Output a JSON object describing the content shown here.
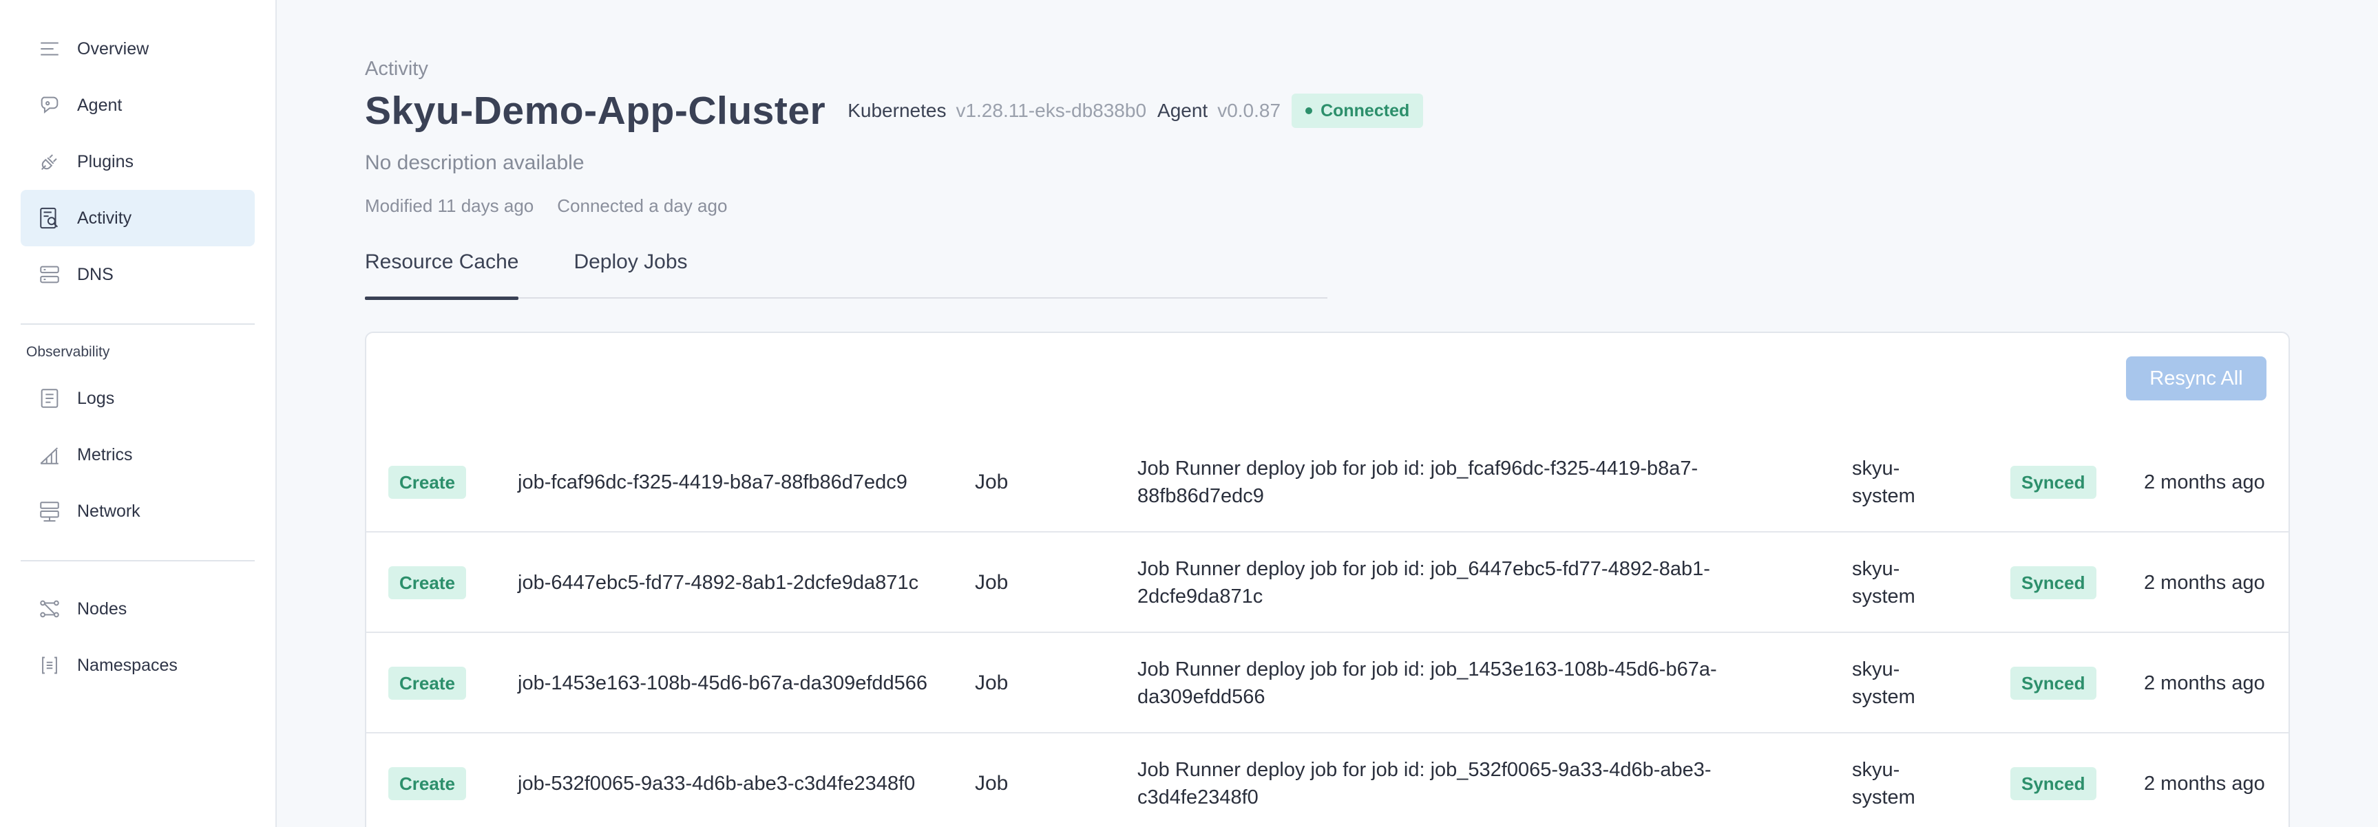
{
  "sidebar": {
    "main_items": [
      {
        "label": "Overview",
        "icon": "overview-lines-icon"
      },
      {
        "label": "Agent",
        "icon": "agent-icon"
      },
      {
        "label": "Plugins",
        "icon": "plug-icon"
      },
      {
        "label": "Activity",
        "icon": "activity-icon",
        "active": true
      },
      {
        "label": "DNS",
        "icon": "dns-icon"
      }
    ],
    "observability_label": "Observability",
    "observability_items": [
      {
        "label": "Logs",
        "icon": "logs-icon"
      },
      {
        "label": "Metrics",
        "icon": "metrics-icon"
      },
      {
        "label": "Network",
        "icon": "network-icon"
      }
    ],
    "cluster_items": [
      {
        "label": "Nodes",
        "icon": "nodes-icon"
      },
      {
        "label": "Namespaces",
        "icon": "namespaces-icon"
      }
    ]
  },
  "header": {
    "breadcrumb": "Activity",
    "title": "Skyu-Demo-App-Cluster",
    "kubernetes_label": "Kubernetes",
    "kubernetes_version": "v1.28.11-eks-db838b0",
    "agent_label": "Agent",
    "agent_version": "v0.0.87",
    "status": "Connected",
    "description": "No description available",
    "modified": "Modified 11 days ago",
    "connected": "Connected a day ago"
  },
  "tabs": [
    {
      "label": "Resource Cache",
      "active": true
    },
    {
      "label": "Deploy Jobs",
      "active": false
    }
  ],
  "table": {
    "resync_label": "Resync All",
    "rows": [
      {
        "action": "Create",
        "name": "job-fcaf96dc-f325-4419-b8a7-88fb86d7edc9",
        "kind": "Job",
        "description": "Job Runner deploy job for job id: job_fcaf96dc-f325-4419-b8a7-88fb86d7edc9",
        "namespace": "skyu-system",
        "status": "Synced",
        "time": "2 months ago"
      },
      {
        "action": "Create",
        "name": "job-6447ebc5-fd77-4892-8ab1-2dcfe9da871c",
        "kind": "Job",
        "description": "Job Runner deploy job for job id: job_6447ebc5-fd77-4892-8ab1-2dcfe9da871c",
        "namespace": "skyu-system",
        "status": "Synced",
        "time": "2 months ago"
      },
      {
        "action": "Create",
        "name": "job-1453e163-108b-45d6-b67a-da309efdd566",
        "kind": "Job",
        "description": "Job Runner deploy job for job id: job_1453e163-108b-45d6-b67a-da309efdd566",
        "namespace": "skyu-system",
        "status": "Synced",
        "time": "2 months ago"
      },
      {
        "action": "Create",
        "name": "job-532f0065-9a33-4d6b-abe3-c3d4fe2348f0",
        "kind": "Job",
        "description": "Job Runner deploy job for job id: job_532f0065-9a33-4d6b-abe3-c3d4fe2348f0",
        "namespace": "skyu-system",
        "status": "Synced",
        "time": "2 months ago"
      }
    ]
  },
  "colors": {
    "accent_green": "#2c8f6b",
    "badge_green_bg": "#d8f3ea",
    "resync_disabled": "#a8c6ec",
    "active_nav_bg": "#e6f1fa"
  }
}
